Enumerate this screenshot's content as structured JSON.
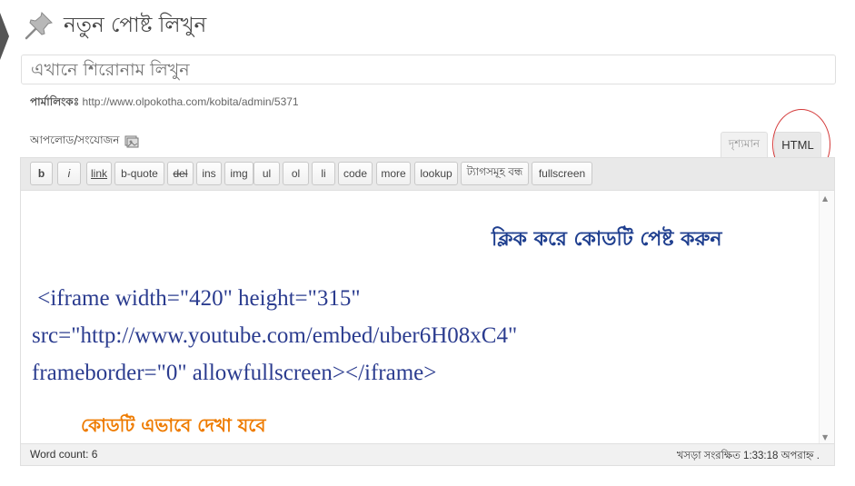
{
  "page": {
    "title": "নতুন পোষ্ট লিখুন",
    "title_placeholder": "এখানে শিরোনাম লিখুন"
  },
  "permalink": {
    "label": "পার্মালিংকঃ",
    "url": "http://www.olpokotha.com/kobita/admin/5371"
  },
  "upload": {
    "label": "আপলোড/সংযোজন",
    "icon": "media-icon"
  },
  "tabs": {
    "visual": "দৃশ্যমান",
    "html": "HTML"
  },
  "toolbar": {
    "buttons": [
      "b",
      "i",
      "link",
      "b-quote",
      "del",
      "ins",
      "img",
      "ul",
      "ol",
      "li",
      "code",
      "more",
      "lookup",
      "ট্যাগসমূহ বন্ধ",
      "fullscreen"
    ]
  },
  "editor": {
    "note_top": "ক্লিক করে কোডটি পেষ্ট করুন",
    "code_line1": " <iframe width=\"420\" height=\"315\"",
    "code_line2": "src=\"http://www.youtube.com/embed/uber6H08xC4\"",
    "code_line3": "frameborder=\"0\" allowfullscreen></iframe>",
    "note_bottom": "কোডটি এভাবে দেখা যবে"
  },
  "status": {
    "word_count": "Word count: 6",
    "draft_saved": "খসড়া সংরক্ষিত 1:33:18 অপরাহ্ন ."
  },
  "colors": {
    "annotation_red": "#d43a3a",
    "note_blue": "#1f3f8f",
    "note_orange": "#ee7b00"
  }
}
